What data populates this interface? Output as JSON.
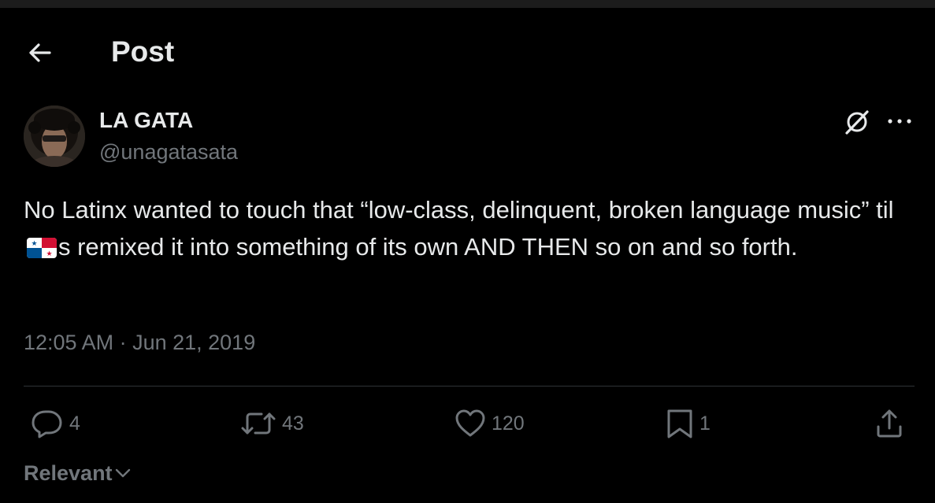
{
  "header": {
    "title": "Post",
    "back_icon": "arrow-left-icon"
  },
  "author": {
    "display_name": "LA GATA",
    "handle": "@unagatasata"
  },
  "post": {
    "text_part1": "No Latinx wanted to touch that “low-class, delinquent, broken language music” til ",
    "flag_icon": "panama-flag-emoji",
    "text_part2": "s remixed it into something of its own AND THEN so on and so forth.",
    "timestamp": "12:05 AM · Jun 21, 2019"
  },
  "actions": {
    "replies": "4",
    "reposts": "43",
    "likes": "120",
    "bookmarks": "1"
  },
  "sort": {
    "label": "Relevant"
  },
  "colors": {
    "background": "#000000",
    "text": "#e7e9ea",
    "secondary": "#71767b",
    "divider": "#2f3336"
  }
}
